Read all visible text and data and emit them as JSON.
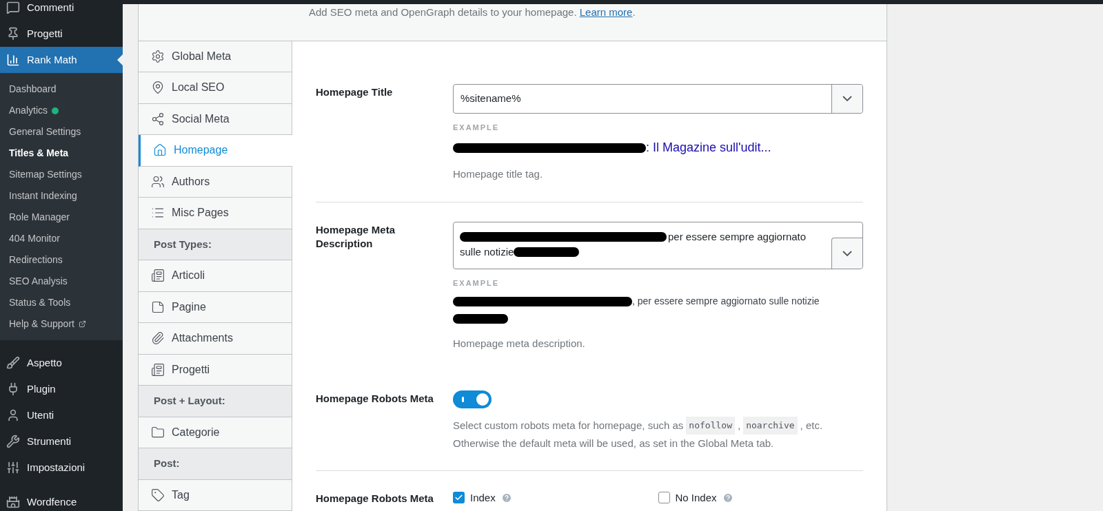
{
  "sidebar": {
    "items": [
      {
        "label": "Commenti",
        "selected": false
      },
      {
        "label": "Progetti",
        "selected": false
      },
      {
        "label": "Rank Math",
        "selected": true,
        "children": [
          {
            "label": "Dashboard",
            "selected": false
          },
          {
            "label": "Analytics",
            "selected": false,
            "color": "#1db37e"
          },
          {
            "label": "General Settings",
            "selected": false
          },
          {
            "label": "Titles & Meta",
            "selected": true
          },
          {
            "label": "Sitemap Settings",
            "selected": false
          },
          {
            "label": "Instant Indexing",
            "selected": false
          },
          {
            "label": "Role Manager",
            "selected": false
          },
          {
            "label": "404 Monitor",
            "selected": false
          },
          {
            "label": "Redirections",
            "selected": false
          },
          {
            "label": "SEO Analysis",
            "selected": false
          },
          {
            "label": "Status & Tools",
            "selected": false
          },
          {
            "label": "Help & Support",
            "selected": false,
            "external": true
          }
        ]
      },
      {
        "label": "Aspetto",
        "selected": false
      },
      {
        "label": "Plugin",
        "selected": false
      },
      {
        "label": "Utenti",
        "selected": false
      },
      {
        "label": "Strumenti",
        "selected": false
      },
      {
        "label": "Impostazioni",
        "selected": false
      },
      {
        "label": "Wordfence",
        "selected": false
      }
    ]
  },
  "header": {
    "text": "Add SEO meta and OpenGraph details to your homepage.",
    "link": "Learn more",
    "after": "."
  },
  "tabs": [
    {
      "kind": "tab",
      "label": "Global Meta",
      "selected": false
    },
    {
      "kind": "tab",
      "label": "Local SEO",
      "selected": false
    },
    {
      "kind": "tab",
      "label": "Social Meta",
      "selected": false
    },
    {
      "kind": "tab",
      "label": "Homepage",
      "selected": true
    },
    {
      "kind": "tab",
      "label": "Authors",
      "selected": false
    },
    {
      "kind": "tab",
      "label": "Misc Pages",
      "selected": false
    },
    {
      "kind": "header",
      "label": "Post Types:"
    },
    {
      "kind": "tab",
      "label": "Articoli",
      "selected": false
    },
    {
      "kind": "tab",
      "label": "Pagine",
      "selected": false
    },
    {
      "kind": "tab",
      "label": "Attachments",
      "selected": false
    },
    {
      "kind": "tab",
      "label": "Progetti",
      "selected": false
    },
    {
      "kind": "header",
      "label": "Post + Layout:"
    },
    {
      "kind": "tab",
      "label": "Categorie",
      "selected": false
    },
    {
      "kind": "header",
      "label": "Post:"
    },
    {
      "kind": "tab",
      "label": "Tag",
      "selected": false
    }
  ],
  "fields": [
    {
      "kind": "select",
      "label": "Homepage Title",
      "value": "%sitename%",
      "example_label": "EXAMPLE",
      "example": ": Il Magazine sull'udit...",
      "description": "Homepage title tag."
    },
    {
      "kind": "textarea",
      "label": "Homepage Meta Description",
      "lines": [
        "per essere sempre aggiornato",
        "sulle notizie"
      ],
      "example_label": "EXAMPLE",
      "example": ", per essere sempre aggiornato sulle notizie",
      "description": "Homepage meta description."
    },
    {
      "kind": "toggle",
      "label": "Homepage Robots Meta",
      "on": true,
      "description": [
        {
          "kind": "text",
          "text": "Select custom robots meta for homepage, such as"
        },
        {
          "kind": "code",
          "text": "nofollow"
        },
        {
          "kind": "text",
          "text": ","
        },
        {
          "kind": "code",
          "text": "noarchive"
        },
        {
          "kind": "text",
          "text": ", etc."
        },
        {
          "kind": "text",
          "text": "Otherwise the default meta will be used, as set in the Global Meta tab."
        }
      ]
    },
    {
      "kind": "checkboxes",
      "label": "Homepage Robots Meta",
      "options": [
        {
          "label": "Index",
          "checked": true
        },
        {
          "label": "No Index",
          "checked": false
        }
      ]
    }
  ]
}
